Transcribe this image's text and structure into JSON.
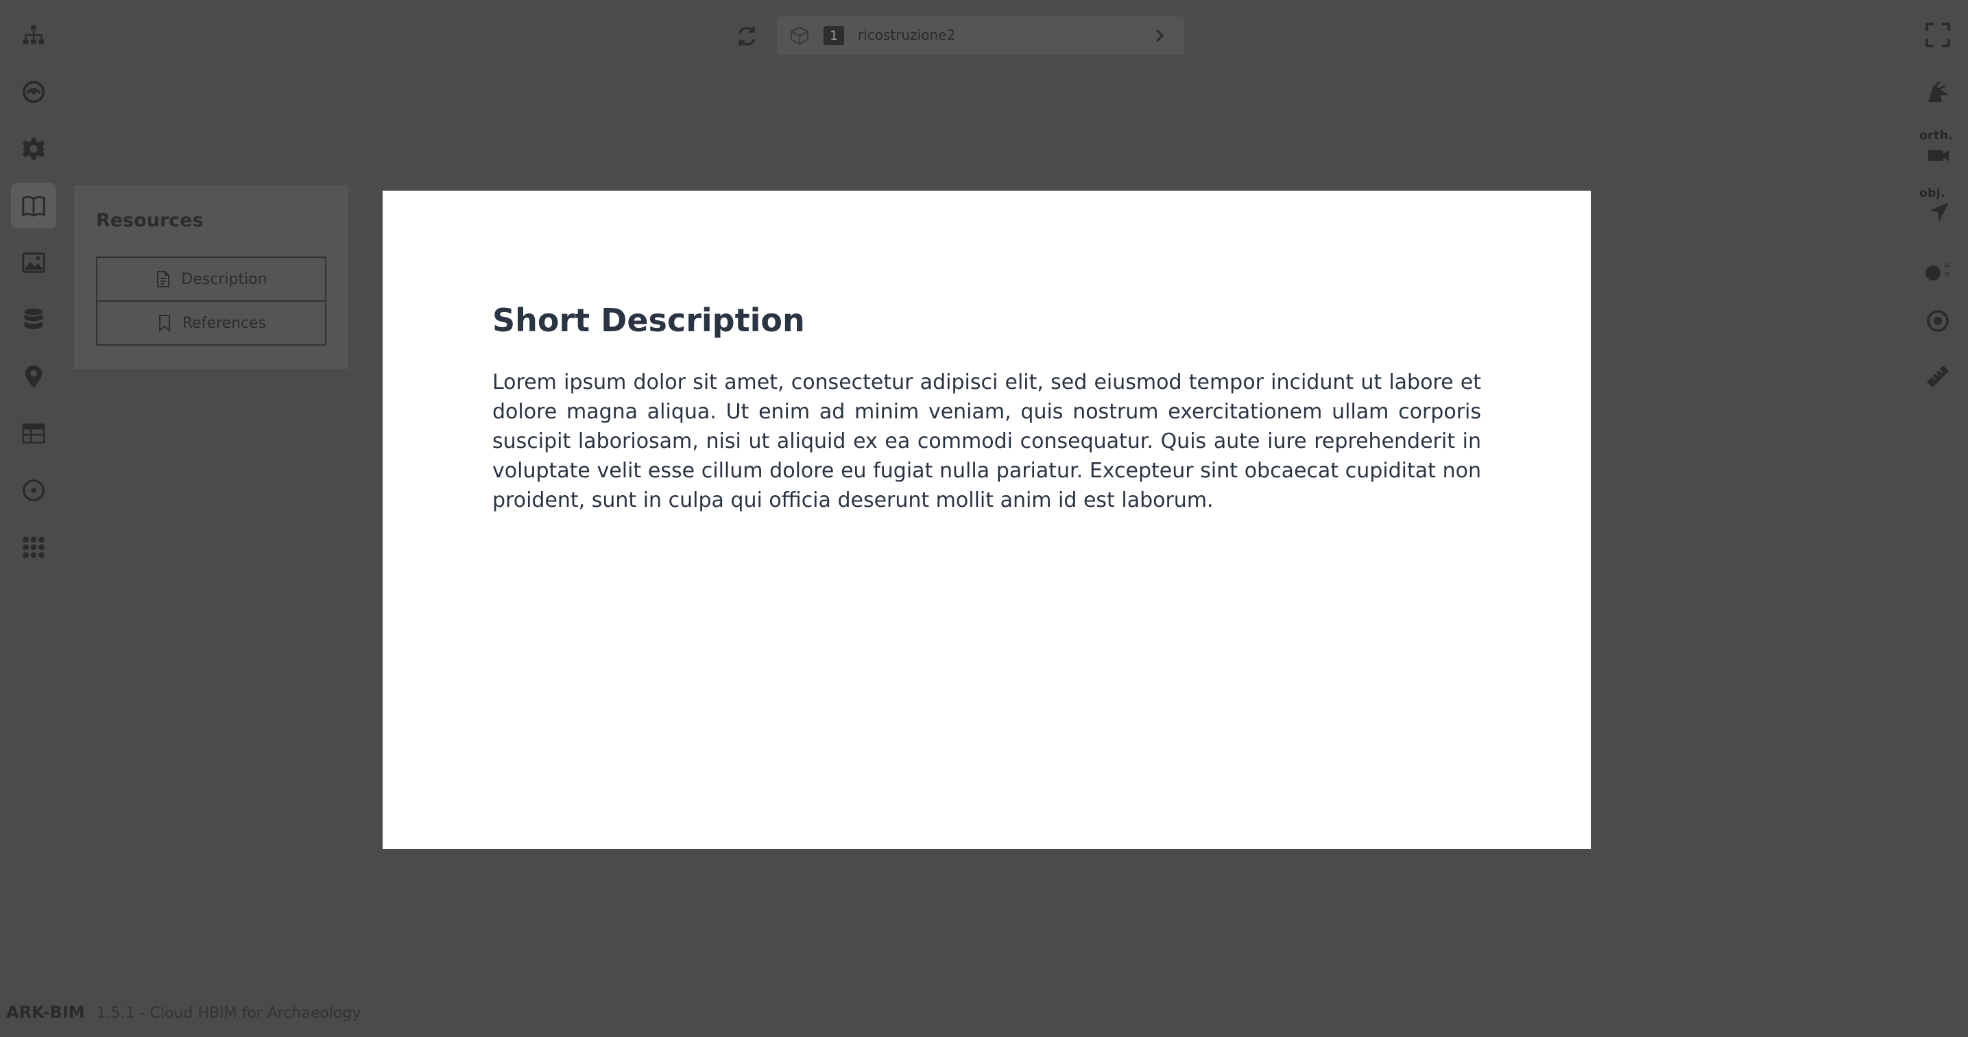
{
  "app": {
    "brand": "ARK-BIM",
    "version_text": "1.5.1 - Cloud HBIM for Archaeology"
  },
  "model_selector": {
    "index": "1",
    "name": "ricostruzione2"
  },
  "left_rail": {
    "items": [
      {
        "icon": "sitemap-icon"
      },
      {
        "icon": "layers-icon"
      },
      {
        "icon": "gear-icon"
      },
      {
        "icon": "book-icon",
        "active": true
      },
      {
        "icon": "images-icon"
      },
      {
        "icon": "database-icon"
      },
      {
        "icon": "map-pin-icon"
      },
      {
        "icon": "table-icon"
      },
      {
        "icon": "compass-icon"
      },
      {
        "icon": "apps-grid-icon"
      }
    ]
  },
  "right_rail": {
    "labels": {
      "orth": "orth.",
      "obj": "obj."
    },
    "tools": [
      "fullscreen-icon",
      "nav-mode-icon",
      "orth-camera-icon",
      "obj-pointer-icon",
      "toggle-2d-3d-icon",
      "target-icon",
      "ruler-icon"
    ]
  },
  "resources_panel": {
    "title": "Resources",
    "buttons": {
      "description": "Description",
      "references": "References"
    }
  },
  "modal": {
    "title": "Short Description",
    "body": "Lorem ipsum dolor sit amet, consectetur adipisci elit, sed eiusmod tempor incidunt ut labore et dolore magna aliqua. Ut enim ad minim veniam, quis nostrum exercitationem ullam corporis suscipit laboriosam, nisi ut aliquid ex ea commodi consequatur. Quis aute iure reprehenderit in voluptate velit esse cillum dolore eu fugiat nulla pariatur. Excepteur sint obcaecat cupiditat non proident, sunt in culpa qui officia deserunt mollit anim id est laborum."
  }
}
